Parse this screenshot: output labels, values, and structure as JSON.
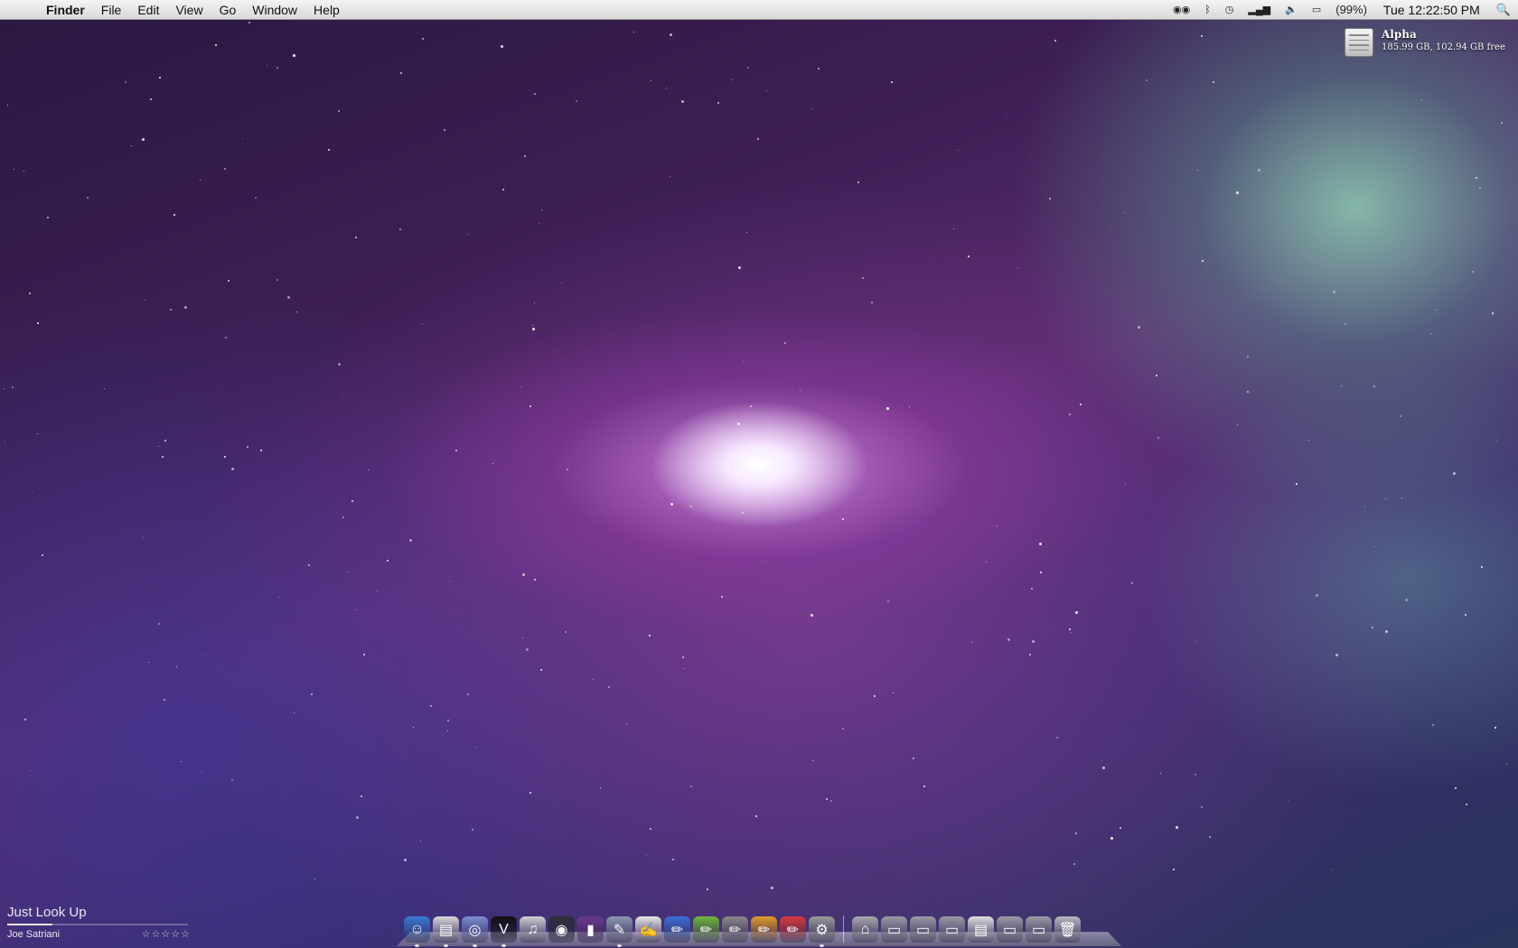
{
  "menubar": {
    "apple_icon": "apple-logo-icon",
    "app_name": "Finder",
    "menus": [
      "File",
      "Edit",
      "View",
      "Go",
      "Window",
      "Help"
    ],
    "status_items": [
      {
        "icon": "remote-access-icon"
      },
      {
        "icon": "bluetooth-icon"
      },
      {
        "icon": "time-machine-icon"
      },
      {
        "icon": "wifi-signal-icon"
      },
      {
        "icon": "volume-icon"
      },
      {
        "icon": "battery-icon"
      }
    ],
    "battery_text": "(99%)",
    "clock": "Tue 12:22:50 PM",
    "spotlight_icon": "spotlight-search-icon"
  },
  "desktop_disk": {
    "name": "Alpha",
    "info": "185.99 GB, 102.94 GB free",
    "icon": "hard-drive-icon"
  },
  "now_playing": {
    "track": "Just Look Up",
    "artist": "Joe Satriani",
    "rating": "☆☆☆☆☆",
    "progress_fraction": 0.25
  },
  "dock": {
    "apps": [
      {
        "name": "finder-icon",
        "glyph": "☺",
        "color": "#3a7bd5",
        "running": true
      },
      {
        "name": "newspaper-icon",
        "glyph": "▤",
        "color": "#d8d8d8",
        "running": true
      },
      {
        "name": "safari-icon",
        "glyph": "◎",
        "color": "#7a8fd0",
        "running": true
      },
      {
        "name": "tuxedo-app-icon",
        "glyph": "V",
        "color": "#111111",
        "running": true
      },
      {
        "name": "headphones-icon",
        "glyph": "♫",
        "color": "#cfcfcf",
        "running": false
      },
      {
        "name": "camera-icon",
        "glyph": "◉",
        "color": "#2f2f3a",
        "running": false
      },
      {
        "name": "app-icon",
        "glyph": "▮",
        "color": "#6a3a8a",
        "running": false
      },
      {
        "name": "paint-brush-icon",
        "glyph": "✎",
        "color": "#8a9ab0",
        "running": true
      },
      {
        "name": "document-icon",
        "glyph": "✍",
        "color": "#e8e8e8",
        "running": false
      },
      {
        "name": "blue-pencil-icon",
        "glyph": "✏",
        "color": "#3b6fd6",
        "running": false
      },
      {
        "name": "green-pencil-icon",
        "glyph": "✏",
        "color": "#6fb83b",
        "running": false
      },
      {
        "name": "gray-pencil-icon",
        "glyph": "✏",
        "color": "#888888",
        "running": false
      },
      {
        "name": "orange-pencil-icon",
        "glyph": "✏",
        "color": "#e29a2b",
        "running": false
      },
      {
        "name": "red-pencil-icon",
        "glyph": "✏",
        "color": "#d63b3b",
        "running": false
      },
      {
        "name": "system-preferences-icon",
        "glyph": "⚙",
        "color": "#9a9a9a",
        "running": true
      }
    ],
    "folders": [
      {
        "name": "home-folder-icon",
        "glyph": "⌂",
        "color": "#a9a9b0"
      },
      {
        "name": "folder-icon",
        "glyph": "▭",
        "color": "#9b9ba4"
      },
      {
        "name": "folder-icon",
        "glyph": "▭",
        "color": "#9b9ba4"
      },
      {
        "name": "folder-icon",
        "glyph": "▭",
        "color": "#9b9ba4"
      },
      {
        "name": "documents-stack-icon",
        "glyph": "▤",
        "color": "#e0e0e0"
      },
      {
        "name": "folder-icon",
        "glyph": "▭",
        "color": "#9b9ba4"
      },
      {
        "name": "folder-icon",
        "glyph": "▭",
        "color": "#9b9ba4"
      },
      {
        "name": "trash-icon",
        "glyph": "🗑",
        "color": "#b8b8c0"
      }
    ]
  }
}
